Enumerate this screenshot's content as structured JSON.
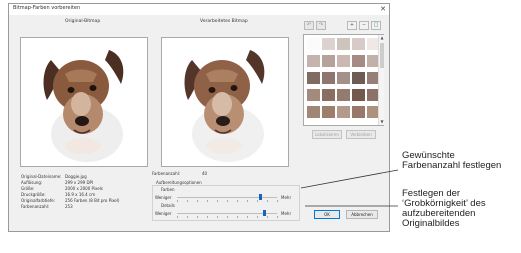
{
  "window": {
    "title": "Bitmap-Farben vorbereiten",
    "close_glyph": "✕"
  },
  "panels": {
    "original_label": "Original-Bitmap",
    "processed_label": "Verarbeitetes Bitmap"
  },
  "toolbar": {
    "undo_glyph": "↶",
    "redo_glyph": "↷",
    "zoom_in_glyph": "+",
    "zoom_out_glyph": "−",
    "zoom_fit_glyph": "□"
  },
  "palette": {
    "colors": [
      "#fbfbfb",
      "#dcd3d0",
      "#cfc3be",
      "#d8cbc7",
      "#efe8e5",
      "#c4b3ae",
      "#b7a19b",
      "#cbb8b3",
      "#a58b84",
      "#c2b0ab",
      "#7f6a64",
      "#8d766f",
      "#a48f89",
      "#6e5b55",
      "#977e77",
      "#a38a7c",
      "#8a6e62",
      "#957a70",
      "#73594c",
      "#8b7167",
      "#a08675",
      "#9c7e6b",
      "#b39a8b",
      "#97786a",
      "#ad917f"
    ]
  },
  "palette_buttons": {
    "lock": "Lokalisieren",
    "unlock": "Verbleiben"
  },
  "info": {
    "rows": [
      {
        "label": "Original-Dateiname:",
        "value": "Doggie.jpg"
      },
      {
        "label": "Auflösung:",
        "value": "299 x 299 DPI"
      },
      {
        "label": "Größe:",
        "value": "2000 x 2000 Pixels"
      },
      {
        "label": "Druckgröße:",
        "value": "16.9 x 16.4 cm"
      },
      {
        "label": "Originalfarbtiefe:",
        "value": "256 Farben (8 Bit pro Pixel)"
      },
      {
        "label": "Farbenanzahl:",
        "value": "253"
      }
    ]
  },
  "options": {
    "color_count_label": "Farbenanzahl:",
    "color_count_value": "40",
    "group_label": "Aufbereitungsoptionen",
    "colors_label": "Farben",
    "colors_min": "Weniger",
    "colors_max": "Mehr",
    "colors_level": 0.83,
    "detail_label": "Details",
    "detail_min": "Weniger",
    "detail_max": "Mehr",
    "detail_level": 0.87
  },
  "buttons": {
    "ok": "OK",
    "cancel": "Abbrechen"
  },
  "callouts": {
    "first": [
      "Gewünschte",
      "Farbenanzahl festlegen"
    ],
    "second": [
      "Festlegen der",
      "‘Grobkörnigkeit’ des",
      "aufzubereitenden",
      "Originalbildes"
    ]
  }
}
